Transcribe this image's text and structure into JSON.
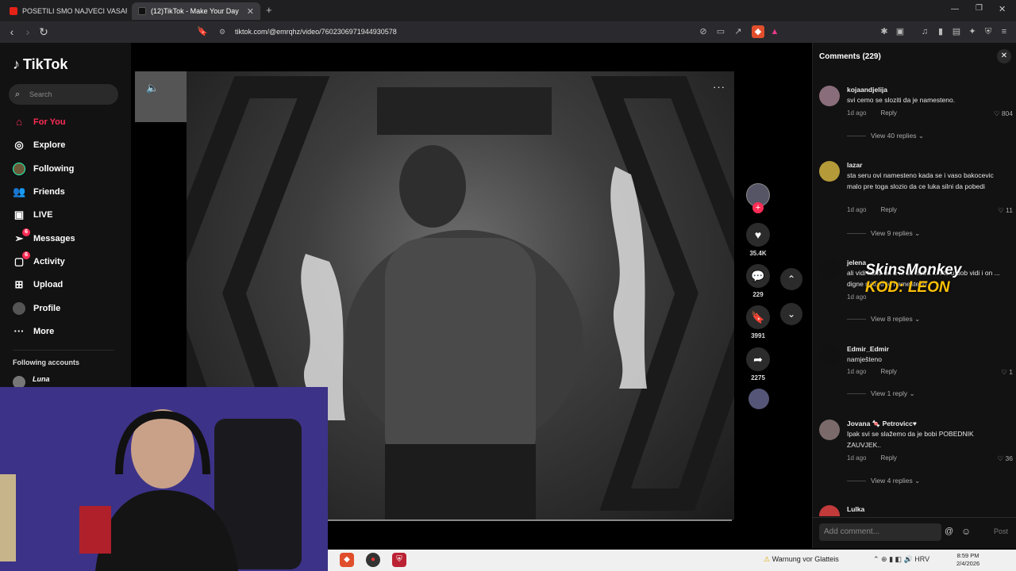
{
  "browser": {
    "tabs": [
      {
        "title": "POSETILI SMO NAJVECI VASAR! - Yo",
        "favicon": "youtube-icon",
        "color": "#e62117"
      },
      {
        "title": "(12)TikTok - Make Your Day",
        "favicon": "tiktok-icon",
        "color": "#000000"
      }
    ],
    "new_tab": "+",
    "url": "tiktok.com/@emrqhz/video/7602306971944930578"
  },
  "tiktok": {
    "logo": "TikTok",
    "search_placeholder": "Search",
    "nav": [
      {
        "label": "For You",
        "icon": "home-icon",
        "active": true
      },
      {
        "label": "Explore",
        "icon": "compass-icon"
      },
      {
        "label": "Following",
        "icon": "following-avatar-icon"
      },
      {
        "label": "Friends",
        "icon": "friends-icon"
      },
      {
        "label": "LIVE",
        "icon": "live-icon"
      },
      {
        "label": "Messages",
        "icon": "messages-icon",
        "badge": "6"
      },
      {
        "label": "Activity",
        "icon": "activity-icon",
        "badge": "6"
      },
      {
        "label": "Upload",
        "icon": "upload-icon"
      },
      {
        "label": "Profile",
        "icon": "profile-avatar-icon"
      },
      {
        "label": "More",
        "icon": "more-icon"
      }
    ],
    "following_accounts_label": "Following accounts",
    "following_account": "Luna"
  },
  "video": {
    "likes": "35.4K",
    "comments": "229",
    "saves": "3991",
    "shares": "2275"
  },
  "comments": {
    "title": "Comments (229)",
    "items": [
      {
        "user": "kojaandjelija",
        "text": "svi cemo se sloziti da je namesteno.",
        "time": "1d ago",
        "reply": "Reply",
        "likes": "804",
        "replies": "View 40 replies",
        "avatar_color": "#8a6d7a"
      },
      {
        "user": "lazar",
        "text": "sta seru ovi namesteno kada se i vaso bakocevic malo pre toga slozio da ce luka silni da pobedi",
        "time": "1d ago",
        "reply": "Reply",
        "likes": "11",
        "replies": "View 9 replies",
        "avatar_color": "#b59a3a"
      },
      {
        "user": "jelena",
        "text": "ali vidi kako on u ... se nutra ... i to u dob vidi i on ... digne ruku tr je namesteno",
        "time": "1d ago",
        "reply": "Reply",
        "likes": "",
        "replies": "View 8 replies",
        "avatar_color": "#111111"
      },
      {
        "user": "Edmir_Edmir",
        "text": "namješteno",
        "time": "1d ago",
        "reply": "Reply",
        "likes": "1",
        "replies": "View 1 reply",
        "avatar_color": "#111111"
      },
      {
        "user": "Jovana 🍬 Petrovicc♥",
        "text": "Ipak svi se slažemo da je bobi POBEDNIK ZAUVJEK..",
        "time": "1d ago",
        "reply": "Reply",
        "likes": "36",
        "replies": "View 4 replies",
        "avatar_color": "#7a6a6a"
      },
      {
        "user": "Lulka",
        "text": "",
        "time": "",
        "reply": "",
        "likes": "",
        "replies": "",
        "avatar_color": "#c23a3a"
      }
    ],
    "add_placeholder": "Add comment...",
    "post": "Post"
  },
  "sponsor": {
    "line1": "SkinsMonkey",
    "line2": "KOD: LEON"
  },
  "taskbar": {
    "warning": "Warnung vor Glatteis",
    "lang": "HRV",
    "time": "8:59 PM",
    "date": "2/4/2026"
  }
}
